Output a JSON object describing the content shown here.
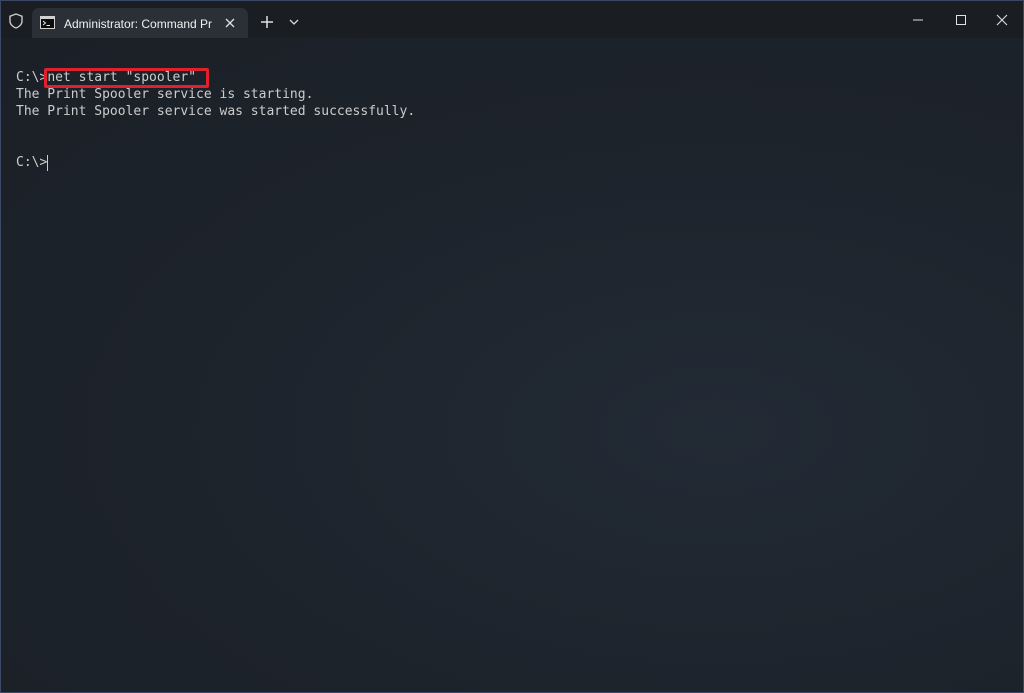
{
  "tab": {
    "title": "Administrator: Command Prompt",
    "icon": "cmd-icon"
  },
  "titlebar": {
    "shield_icon": "shield-icon",
    "new_tab_icon": "plus-icon",
    "dropdown_icon": "chevron-down-icon"
  },
  "window_controls": {
    "minimize_icon": "minimize-icon",
    "maximize_icon": "maximize-icon",
    "close_icon": "close-icon"
  },
  "console": {
    "prompt": "C:\\>",
    "command": "net start \"spooler\"",
    "output_line_1": "The Print Spooler service is starting.",
    "output_line_2": "The Print Spooler service was started successfully.",
    "current_prompt": "C:\\>",
    "highlight_color": "#e0202c"
  }
}
